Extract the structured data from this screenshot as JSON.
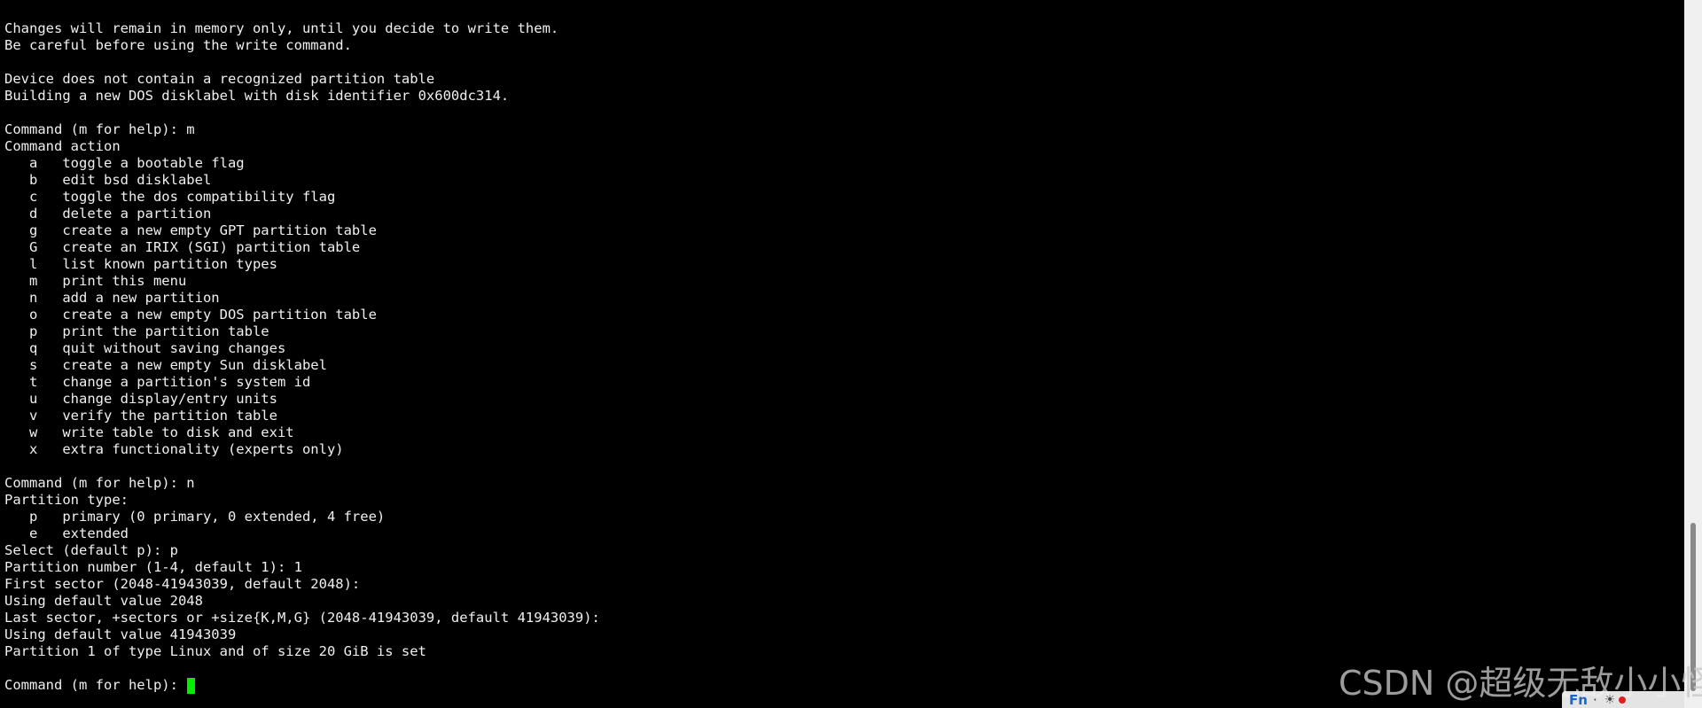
{
  "terminal": {
    "lines": [
      "Changes will remain in memory only, until you decide to write them.",
      "Be careful before using the write command.",
      "",
      "Device does not contain a recognized partition table",
      "Building a new DOS disklabel with disk identifier 0x600dc314.",
      "",
      "Command (m for help): m",
      "Command action",
      "   a   toggle a bootable flag",
      "   b   edit bsd disklabel",
      "   c   toggle the dos compatibility flag",
      "   d   delete a partition",
      "   g   create a new empty GPT partition table",
      "   G   create an IRIX (SGI) partition table",
      "   l   list known partition types",
      "   m   print this menu",
      "   n   add a new partition",
      "   o   create a new empty DOS partition table",
      "   p   print the partition table",
      "   q   quit without saving changes",
      "   s   create a new empty Sun disklabel",
      "   t   change a partition's system id",
      "   u   change display/entry units",
      "   v   verify the partition table",
      "   w   write table to disk and exit",
      "   x   extra functionality (experts only)",
      "",
      "Command (m for help): n",
      "Partition type:",
      "   p   primary (0 primary, 0 extended, 4 free)",
      "   e   extended",
      "Select (default p): p",
      "Partition number (1-4, default 1): 1",
      "First sector (2048-41943039, default 2048):",
      "Using default value 2048",
      "Last sector, +sectors or +size{K,M,G} (2048-41943039, default 41943039):",
      "Using default value 41943039",
      "Partition 1 of type Linux and of size 20 GiB is set",
      ""
    ],
    "prompt": "Command (m for help): ",
    "cursor_color": "#00ee00",
    "background_color": "#000000",
    "text_color": "#f0f0f0"
  },
  "watermark": {
    "text": "CSDN @超级无敌小小怪"
  },
  "ime": {
    "language": "Fn",
    "separator": "·",
    "icon": "half-width-icon",
    "icon_glyph": "☀"
  }
}
